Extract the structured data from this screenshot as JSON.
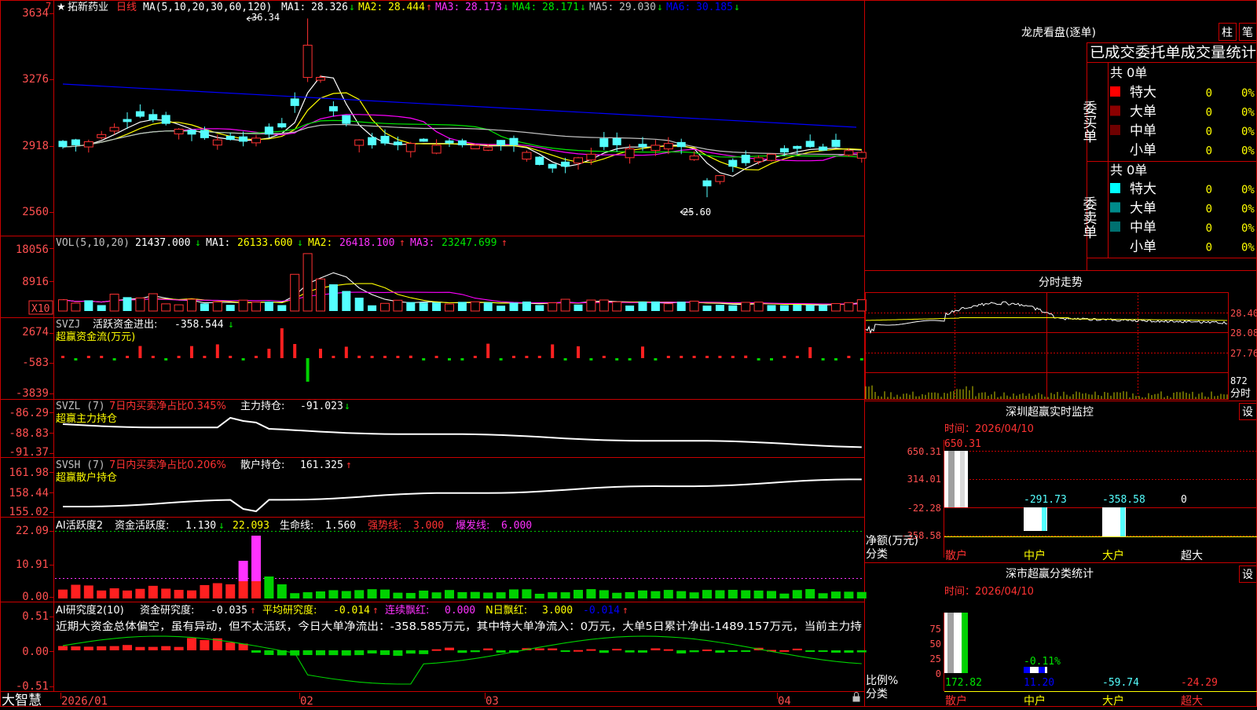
{
  "colors": {
    "up": "#ff3232",
    "down": "#54ffff",
    "flat": "#ffffff",
    "grid": "#c80000",
    "axis_text": "#ff5050",
    "ma1": "#ffffff",
    "ma2": "#ffff00",
    "ma3": "#ff00ff",
    "ma4": "#00e600",
    "ma5": "#c0c0c0",
    "ma6": "#0000ff",
    "green_bar": "#00d200",
    "magenta": "#ff32ff"
  },
  "main_chart": {
    "title_star": "★",
    "stock_name": "拓新药业",
    "period": "日线",
    "ma_label": "MA(5,10,20,30,60,120)",
    "ma1_label": "MA1:",
    "ma1": "28.326",
    "ma1_arrow": "↓",
    "ma2_label": "MA2:",
    "ma2": "28.444",
    "ma2_arrow": "↑",
    "ma3_label": "MA3:",
    "ma3": "28.173",
    "ma3_arrow": "↓",
    "ma4_label": "MA4:",
    "ma4": "28.171",
    "ma4_arrow": "↓",
    "ma5_label": "MA5:",
    "ma5": "29.030",
    "ma5_arrow": "↓",
    "ma6_label": "MA6:",
    "ma6": "30.185",
    "ma6_arrow": "↓",
    "y_ticks": [
      "3634",
      "3276",
      "2918",
      "2560"
    ],
    "high_label": "36.34",
    "low_label": "25.60",
    "badge": "7"
  },
  "vol_panel": {
    "label": "VOL(5,10,20)",
    "value": "21437.000",
    "value_arrow": "↓",
    "ma1_label": "MA1:",
    "ma1": "26133.600",
    "ma1_arrow": "↓",
    "ma2_label": "MA2:",
    "ma2": "26418.100",
    "ma2_arrow": "↑",
    "ma3_label": "MA3:",
    "ma3": "23247.699",
    "ma3_arrow": "↑",
    "y_ticks": [
      "18056",
      "8916"
    ],
    "scale_badge": "X10"
  },
  "svzj_panel": {
    "label": "SVZJ",
    "line_label": "活跃资金进出:",
    "value": "-358.544",
    "value_arrow": "↓",
    "subtitle": "超赢资金流(万元)",
    "y_ticks": [
      "2674",
      "-583",
      "-3839"
    ]
  },
  "svzl_panel": {
    "label": "SVZL (7)",
    "ratio_label": "7日内买卖净占比0.345%",
    "line_label": "主力持仓:",
    "value": "-91.023",
    "value_arrow": "↓",
    "subtitle": "超赢主力持仓",
    "y_ticks": [
      "-86.29",
      "-88.83",
      "-91.37"
    ]
  },
  "svsh_panel": {
    "label": "SVSH (7)",
    "ratio_label": "7日内买卖净占比0.206%",
    "line_label": "散户持仓:",
    "value": "161.325",
    "value_arrow": "↑",
    "subtitle": "超赢散户持仓",
    "y_ticks": [
      "161.98",
      "158.44",
      "155.02"
    ]
  },
  "ai_active_panel": {
    "label": "AI活跃度2",
    "f1_label": "资金活跃度:",
    "f1": "1.130",
    "f1_arrow": "↓",
    "f2": "22.093",
    "f3_label": "生命线:",
    "f3": "1.560",
    "f4_label": "强势线:",
    "f4": "3.000",
    "f5_label": "爆发线:",
    "f5": "6.000",
    "y_ticks": [
      "22.09",
      "10.91",
      "0.00"
    ]
  },
  "ai_research_panel": {
    "label": "AI研究度2(10)",
    "f1_label": "资金研究度:",
    "f1": "-0.035",
    "f1_arrow": "↑",
    "f2_label": "平均研究度:",
    "f2": "-0.014",
    "f2_arrow": "↑",
    "f3_label": "连续飘红:",
    "f3": "0.000",
    "f4_label": "N日飘红:",
    "f4": "3.000",
    "f5": "-0.014",
    "f5_arrow": "↑",
    "summary": "近期大资金总体偏空，虽有异动，但不太活跃，今日大单净流出：-358.585万元，其中特大单净流入：0万元，大单5日累计净出-1489.157万元，当前主力持",
    "y_ticks": [
      "0.51",
      "0.00",
      "-0.51"
    ]
  },
  "bottom_bar": {
    "brand": "大智慧",
    "dates": [
      "2026/01",
      "02",
      "03",
      "04"
    ]
  },
  "dragon_panel": {
    "title": "龙虎看盘(逐单)",
    "btn1": "柱",
    "btn2": "笔",
    "subtitle": "已成交委托单成交量统计",
    "buy_group_label": "委买单",
    "buy_total": "共 0单",
    "buy_rows": [
      {
        "name": "特大",
        "count": "0",
        "pct": "0%",
        "color": "#ff0000"
      },
      {
        "name": "大单",
        "count": "0",
        "pct": "0%",
        "color": "#8b0000"
      },
      {
        "name": "中单",
        "count": "0",
        "pct": "0%",
        "color": "#6e0000"
      },
      {
        "name": "小单",
        "count": "0",
        "pct": "0%",
        "color": "#000000"
      }
    ],
    "sell_group_label": "委卖单",
    "sell_total": "共 0单",
    "sell_rows": [
      {
        "name": "特大",
        "count": "0",
        "pct": "0%",
        "color": "#00ffff"
      },
      {
        "name": "大单",
        "count": "0",
        "pct": "0%",
        "color": "#008b8b"
      },
      {
        "name": "中单",
        "count": "0",
        "pct": "0%",
        "color": "#007070"
      },
      {
        "name": "小单",
        "count": "0",
        "pct": "0%",
        "color": "#000000"
      }
    ]
  },
  "intraday_panel": {
    "title": "分时走势",
    "y_ticks": [
      "28.40",
      "28.08",
      "27.76"
    ],
    "vol_tick": "872",
    "vol_label": "分时"
  },
  "sz_monitor": {
    "title": "深圳超赢实时监控",
    "btn": "设",
    "time_label": "时间：2026/04/10",
    "y_ticks": [
      "650.31",
      "314.01",
      "-22.28",
      "-358.58"
    ],
    "y_axis_label1": "净额(万元)",
    "y_axis_label2": "分类",
    "bar_labels": [
      "650.31",
      "-291.73",
      "-358.58",
      "0"
    ],
    "categories": [
      "散户",
      "中户",
      "大户",
      "超大"
    ]
  },
  "sz_class": {
    "title": "深市超赢分类统计",
    "btn": "设",
    "time_label": "时间：2026/04/10",
    "y_ticks": [
      "75",
      "50",
      "25",
      "0"
    ],
    "y_axis_label1": "比例%",
    "y_axis_label2": "分类",
    "bar_top_label": "-0.11%",
    "values": [
      "172.82",
      "11.20",
      "-59.74",
      "-24.29"
    ],
    "categories": [
      "散户",
      "中户",
      "大户",
      "超大"
    ]
  }
}
